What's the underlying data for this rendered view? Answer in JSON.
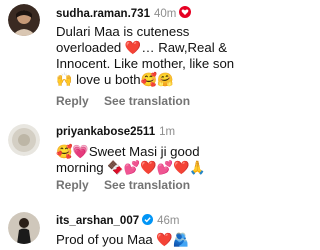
{
  "comments": [
    {
      "username": "sudha.raman.731",
      "time": "40m",
      "text_lines": [
        "Dulari Maa is cuteness",
        "overloaded ❤️… Raw,Real &",
        "Innocent. Like mother, like son",
        "🙌 love u both🥰🤗"
      ],
      "reply_label": "Reply",
      "translate_label": "See translation"
    },
    {
      "username": "priyankabose2511",
      "time": "1m",
      "text_lines": [
        "🥰💗Sweet Masi ji good",
        "morning 🍫💕❤️💕❤️🙏"
      ],
      "reply_label": "Reply",
      "translate_label": "See translation"
    },
    {
      "username": "its_arshan_007",
      "time": "46m",
      "verified": true,
      "text_lines": [
        "Prod of you Maa ❤️🫂"
      ]
    }
  ]
}
